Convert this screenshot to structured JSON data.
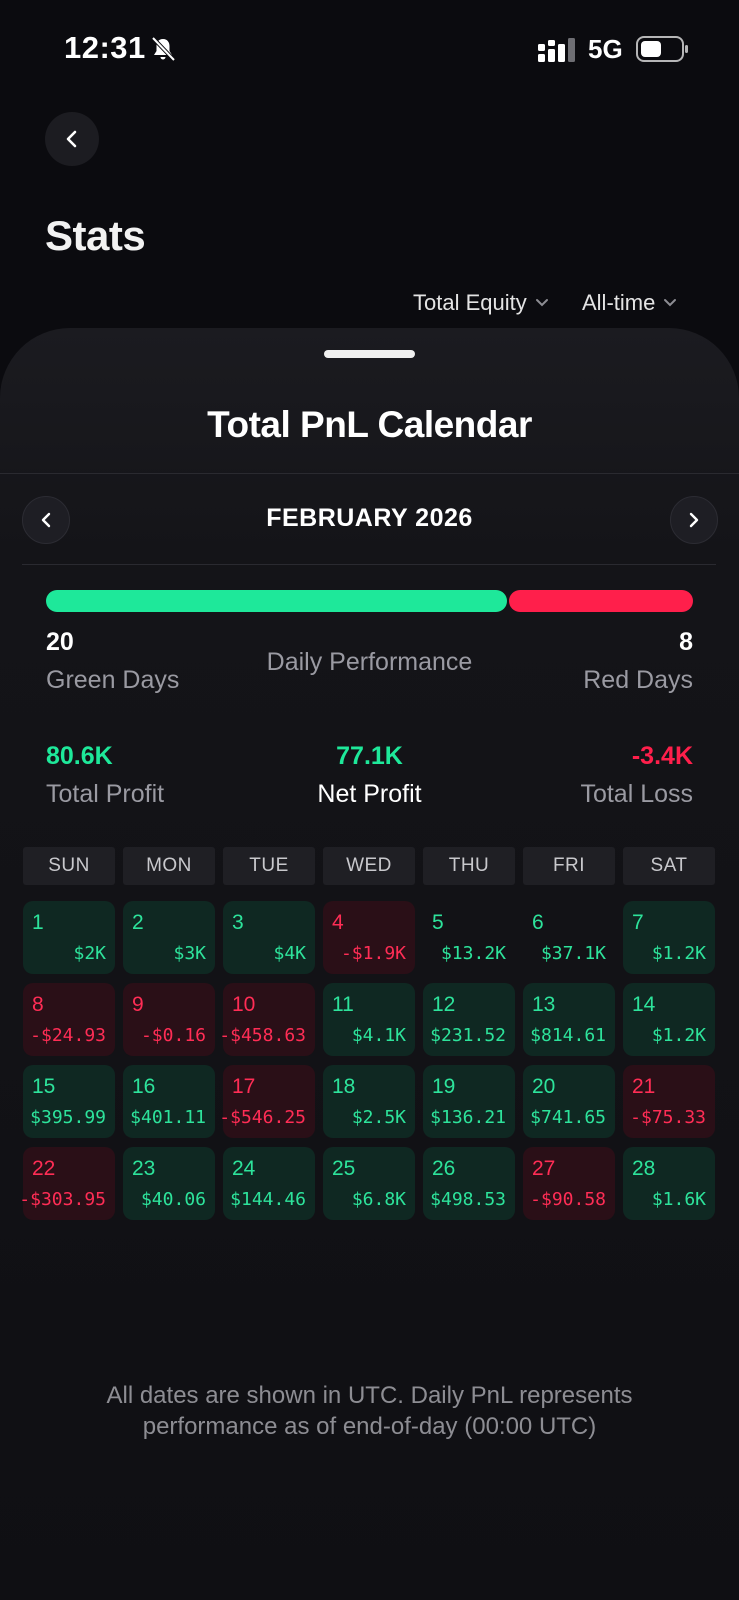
{
  "status_bar": {
    "time": "12:31",
    "network": "5G",
    "icons": [
      "bell-muted-icon",
      "signal-icon",
      "battery-icon"
    ]
  },
  "header": {
    "title": "Stats",
    "filters": {
      "metric": "Total Equity",
      "range": "All-time"
    }
  },
  "sheet": {
    "title": "Total PnL Calendar",
    "month": "FEBRUARY 2026",
    "performance": {
      "green_days": "20",
      "green_label": "Green Days",
      "label": "Daily Performance",
      "red_days": "8",
      "red_label": "Red Days",
      "green_fraction": 0.714
    },
    "summary": {
      "total_profit": "80.6K",
      "total_profit_label": "Total Profit",
      "net_profit": "77.1K",
      "net_profit_label": "Net Profit",
      "total_loss": "-3.4K",
      "total_loss_label": "Total Loss"
    },
    "weekdays": [
      "SUN",
      "MON",
      "TUE",
      "WED",
      "THU",
      "FRI",
      "SAT"
    ],
    "days": [
      {
        "day": "1",
        "value": "$2K",
        "type": "pos"
      },
      {
        "day": "2",
        "value": "$3K",
        "type": "pos"
      },
      {
        "day": "3",
        "value": "$4K",
        "type": "pos"
      },
      {
        "day": "4",
        "value": "-$1.9K",
        "type": "neg"
      },
      {
        "day": "5",
        "value": "$13.2K",
        "type": "pos"
      },
      {
        "day": "6",
        "value": "$37.1K",
        "type": "pos"
      },
      {
        "day": "7",
        "value": "$1.2K",
        "type": "pos"
      },
      {
        "day": "8",
        "value": "-$24.93",
        "type": "neg"
      },
      {
        "day": "9",
        "value": "-$0.16",
        "type": "neg"
      },
      {
        "day": "10",
        "value": "-$458.63",
        "type": "neg"
      },
      {
        "day": "11",
        "value": "$4.1K",
        "type": "pos"
      },
      {
        "day": "12",
        "value": "$231.52",
        "type": "pos"
      },
      {
        "day": "13",
        "value": "$814.61",
        "type": "pos"
      },
      {
        "day": "14",
        "value": "$1.2K",
        "type": "pos"
      },
      {
        "day": "15",
        "value": "$395.99",
        "type": "pos"
      },
      {
        "day": "16",
        "value": "$401.11",
        "type": "pos"
      },
      {
        "day": "17",
        "value": "-$546.25",
        "type": "neg"
      },
      {
        "day": "18",
        "value": "$2.5K",
        "type": "pos"
      },
      {
        "day": "19",
        "value": "$136.21",
        "type": "pos"
      },
      {
        "day": "20",
        "value": "$741.65",
        "type": "pos"
      },
      {
        "day": "21",
        "value": "-$75.33",
        "type": "neg"
      },
      {
        "day": "22",
        "value": "-$303.95",
        "type": "neg"
      },
      {
        "day": "23",
        "value": "$40.06",
        "type": "pos"
      },
      {
        "day": "24",
        "value": "$144.46",
        "type": "pos"
      },
      {
        "day": "25",
        "value": "$6.8K",
        "type": "pos"
      },
      {
        "day": "26",
        "value": "$498.53",
        "type": "pos"
      },
      {
        "day": "27",
        "value": "-$90.58",
        "type": "neg"
      },
      {
        "day": "28",
        "value": "$1.6K",
        "type": "pos"
      }
    ],
    "footnote": {
      "line1": "All dates are shown in UTC. Daily PnL represents",
      "line2": "performance as of end-of-day (00:00 UTC)"
    }
  },
  "colors": {
    "green": "#1ee89a",
    "red": "#ff1f4b",
    "background": "#0b0b0f"
  }
}
